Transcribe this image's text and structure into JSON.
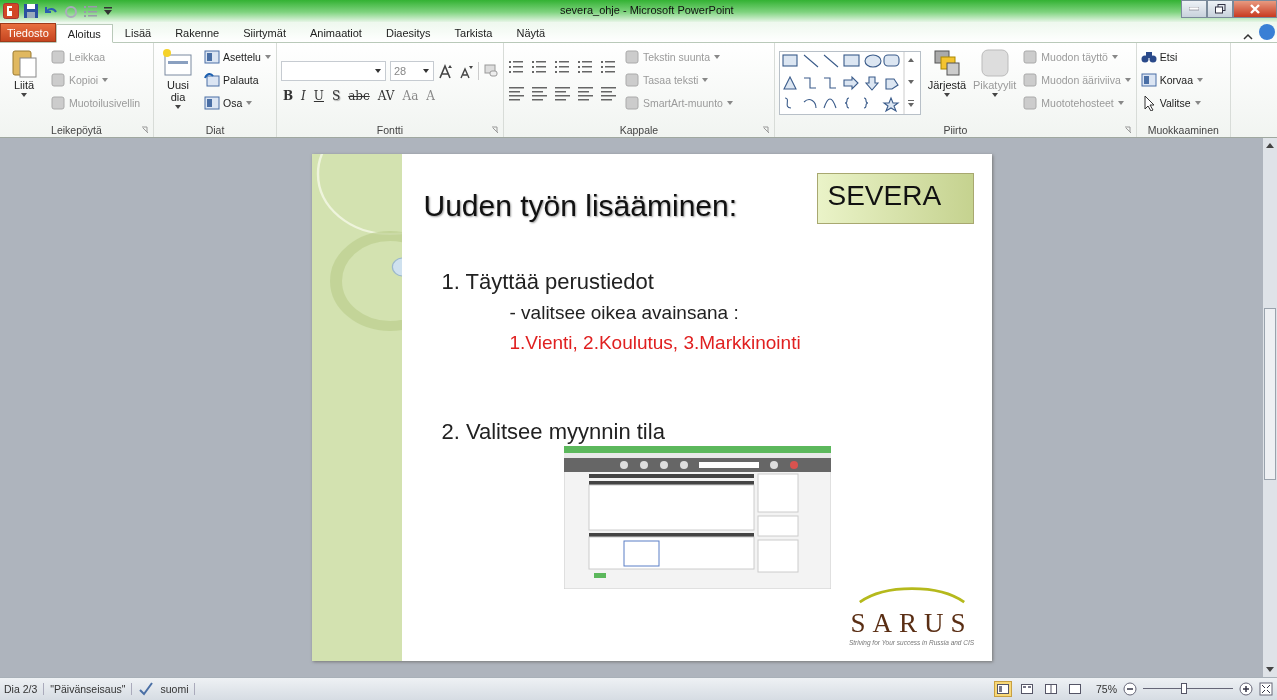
{
  "window": {
    "title": "severa_ohje - Microsoft PowerPoint"
  },
  "tabs": [
    {
      "label": "Tiedosto",
      "kind": "file",
      "selected": false
    },
    {
      "label": "Aloitus",
      "kind": "tab",
      "selected": true
    },
    {
      "label": "Lisää",
      "kind": "tab",
      "selected": false
    },
    {
      "label": "Rakenne",
      "kind": "tab",
      "selected": false
    },
    {
      "label": "Siirtymät",
      "kind": "tab",
      "selected": false
    },
    {
      "label": "Animaatiot",
      "kind": "tab",
      "selected": false
    },
    {
      "label": "Diaesitys",
      "kind": "tab",
      "selected": false
    },
    {
      "label": "Tarkista",
      "kind": "tab",
      "selected": false
    },
    {
      "label": "Näytä",
      "kind": "tab",
      "selected": false
    }
  ],
  "ribbon": {
    "groups": [
      {
        "label": "Leikepöytä",
        "kind": "standard",
        "large": [
          {
            "label": "Liitä",
            "dropdown": true,
            "disabled": false
          }
        ],
        "small": [
          {
            "label": "Leikkaa",
            "dropdown": false,
            "disabled": true
          },
          {
            "label": "Kopioi",
            "dropdown": true,
            "disabled": true
          },
          {
            "label": "Muotoilusivellin",
            "dropdown": false,
            "disabled": true
          }
        ]
      },
      {
        "label": "Diat",
        "kind": "standard",
        "large": [
          {
            "label": "Uusi dia",
            "dropdown": true,
            "disabled": false
          }
        ],
        "small": [
          {
            "label": "Asettelu",
            "dropdown": true,
            "disabled": false
          },
          {
            "label": "Palauta",
            "dropdown": false,
            "disabled": false
          },
          {
            "label": "Osa",
            "dropdown": true,
            "disabled": false
          }
        ]
      },
      {
        "label": "Fontti",
        "kind": "font",
        "font_size": "28",
        "format_buttons": [
          "B",
          "I",
          "U",
          "S",
          "abc",
          "AV",
          "Aa",
          "A"
        ]
      },
      {
        "label": "Kappale",
        "kind": "paragraph",
        "small": [
          {
            "label": "Tekstin suunta",
            "dropdown": true,
            "disabled": true
          },
          {
            "label": "Tasaa teksti",
            "dropdown": true,
            "disabled": true
          },
          {
            "label": "SmartArt-muunto",
            "dropdown": true,
            "disabled": true
          }
        ]
      },
      {
        "label": "Piirto",
        "kind": "drawing",
        "large": [
          {
            "label": "Järjestä",
            "dropdown": true,
            "disabled": false
          },
          {
            "label": "Pikatyylit",
            "dropdown": true,
            "disabled": true
          }
        ],
        "small": [
          {
            "label": "Muodon täyttö",
            "dropdown": true,
            "disabled": true
          },
          {
            "label": "Muodon ääriviiva",
            "dropdown": true,
            "disabled": true
          },
          {
            "label": "Muototehosteet",
            "dropdown": true,
            "disabled": true
          }
        ]
      },
      {
        "label": "Muokkaaminen",
        "kind": "standard",
        "small": [
          {
            "label": "Etsi",
            "dropdown": false,
            "disabled": false
          },
          {
            "label": "Korvaa",
            "dropdown": true,
            "disabled": false
          },
          {
            "label": "Valitse",
            "dropdown": true,
            "disabled": false
          }
        ]
      }
    ]
  },
  "slide": {
    "title": "Uuden työn lisääminen:",
    "badge": "SEVERA",
    "steps": [
      {
        "text": "1. Täyttää perustiedot",
        "sub": [
          {
            "text": "- valitsee oikea avainsana :",
            "kind": "plain"
          },
          {
            "text": "1.Vienti, 2.Koulutus, 3.Markkinointi",
            "kind": "highlight"
          }
        ]
      },
      {
        "text": "2. Valitsee myynnin tila"
      }
    ],
    "logo": {
      "name": "SARUS",
      "tagline": "Striving for Your success in Russia and CIS"
    }
  },
  "status_bar": {
    "slide": "Dia 2/3",
    "theme": "\"Päivänseisaus\"",
    "language": "suomi",
    "zoom": "75%",
    "zoom_slider": {
      "level": 0.45
    },
    "views": [
      {
        "selected": true
      },
      {
        "selected": false
      },
      {
        "selected": false
      },
      {
        "selected": false
      }
    ]
  }
}
